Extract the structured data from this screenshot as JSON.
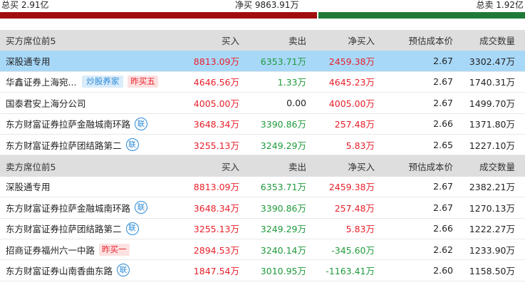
{
  "summary": {
    "total_buy": "总买 2.91亿",
    "net_buy": "净买 9863.91万",
    "total_sell": "总卖 1.92亿"
  },
  "colors": {
    "buy_bar": "#a10d0d",
    "sell_bar": "#1e7a36",
    "highlight": "#a8d8f8",
    "up": "#e8202a",
    "down": "#1f9a3c"
  },
  "buy_section": {
    "headers": {
      "name": "买方席位前5",
      "buy": "买入",
      "sell": "卖出",
      "net": "净买入",
      "cost": "预估成本价",
      "volume": "成交数量"
    },
    "rows": [
      {
        "name": "深股通专用",
        "buy": "8813.09万",
        "sell": "6353.71万",
        "net": "2459.38万",
        "cost": "2.67",
        "volume": "3302.47万"
      },
      {
        "name": "华鑫证券上海宛...",
        "tag1": "炒股养家",
        "tag2": "昨买五",
        "buy": "4646.56万",
        "sell": "1.33万",
        "net": "4645.23万",
        "cost": "2.67",
        "volume": "1740.31万"
      },
      {
        "name": "国泰君安上海分公司",
        "buy": "4005.00万",
        "sell": "0.00",
        "net": "4005.00万",
        "cost": "2.67",
        "volume": "1499.70万"
      },
      {
        "name": "东方财富证券拉萨金融城南环路",
        "icon": "联",
        "buy": "3648.34万",
        "sell": "3390.86万",
        "net": "257.48万",
        "cost": "2.66",
        "volume": "1371.80万"
      },
      {
        "name": "东方财富证券拉萨团结路第二",
        "icon": "联",
        "buy": "3255.13万",
        "sell": "3249.29万",
        "net": "5.83万",
        "cost": "2.65",
        "volume": "1227.10万"
      }
    ]
  },
  "sell_section": {
    "headers": {
      "name": "卖方席位前5",
      "buy": "买入",
      "sell": "卖出",
      "net": "净买入",
      "cost": "预估成本价",
      "volume": "成交数量"
    },
    "rows": [
      {
        "name": "深股通专用",
        "buy": "8813.09万",
        "sell": "6353.71万",
        "net": "2459.38万",
        "cost": "2.67",
        "volume": "2382.21万"
      },
      {
        "name": "东方财富证券拉萨金融城南环路",
        "icon": "联",
        "buy": "3648.34万",
        "sell": "3390.86万",
        "net": "257.48万",
        "cost": "2.67",
        "volume": "1270.13万"
      },
      {
        "name": "东方财富证券拉萨团结路第二",
        "icon": "联",
        "buy": "3255.13万",
        "sell": "3249.29万",
        "net": "5.83万",
        "cost": "2.66",
        "volume": "1222.27万"
      },
      {
        "name": "招商证券福州六一中路",
        "tag2": "昨买一",
        "buy": "2894.53万",
        "sell": "3240.14万",
        "net": "-345.60万",
        "cost": "2.62",
        "volume": "1233.90万"
      },
      {
        "name": "东方财富证券山南香曲东路",
        "icon": "联",
        "buy": "1847.54万",
        "sell": "3010.95万",
        "net": "-1163.41万",
        "cost": "2.60",
        "volume": "1158.50万"
      }
    ]
  }
}
